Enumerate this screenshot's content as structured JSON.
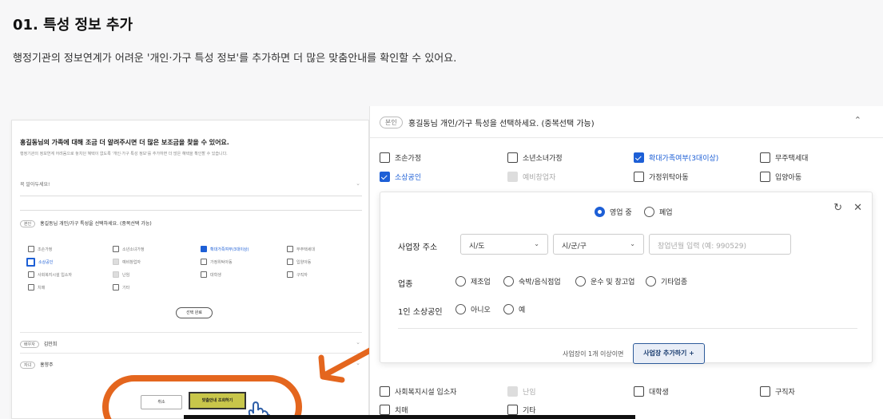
{
  "header": {
    "title": "01. 특성 정보 추가",
    "subtitle": "행정기관의 정보연계가 어려운 '개인·가구 특성 정보'를 추가하면 더 많은 맞춤안내를 확인할 수 있어요."
  },
  "left_panel": {
    "question": "홍길동님의 가족에 대해 조금 더 알려주시면 더 많은 보조금을 찾을 수 있어요.",
    "description": "행정기관의 정보연계 어려움으로 놓치던 혜택이 없도록 '개인·가구 특성 정보'를 추가하면 더 많은 혜택을 확인할 수 있습니다.",
    "input_placeholder": "꼭 알아두세요!",
    "section_badge": "본인",
    "section_title": "홍길동님 개인/가구 특성을 선택하세요. (중복선택 가능)",
    "options": [
      {
        "label": "조손가정",
        "state": "off"
      },
      {
        "label": "소년소녀가정",
        "state": "off"
      },
      {
        "label": "확대가족여부(3대이상)",
        "state": "on"
      },
      {
        "label": "무주택세대",
        "state": "off"
      },
      {
        "label": "소상공인",
        "state": "highlight"
      },
      {
        "label": "예비창업자",
        "state": "gray"
      },
      {
        "label": "가정위탁아동",
        "state": "off"
      },
      {
        "label": "입양아동",
        "state": "off"
      },
      {
        "label": "사회복지시설 입소자",
        "state": "off"
      },
      {
        "label": "난임",
        "state": "gray"
      },
      {
        "label": "대학생",
        "state": "off"
      },
      {
        "label": "구직자",
        "state": "off"
      },
      {
        "label": "치매",
        "state": "off"
      },
      {
        "label": "기타",
        "state": "off"
      }
    ],
    "select_done": "선택 완료",
    "members": [
      {
        "badge": "배우자",
        "name": "김민희"
      },
      {
        "badge": "자녀",
        "name": "홍향주"
      }
    ],
    "cancel_label": "취소",
    "view_label": "맞춤안내 조회하기"
  },
  "right_panel": {
    "badge": "본인",
    "title": "홍길동님 개인/가구 특성을 선택하세요. (중복선택 가능)",
    "options_top": [
      {
        "label": "조손가정",
        "state": "off"
      },
      {
        "label": "소년소녀가정",
        "state": "off"
      },
      {
        "label": "확대가족여부(3대이상)",
        "state": "on"
      },
      {
        "label": "무주택세대",
        "state": "off"
      },
      {
        "label": "소상공인",
        "state": "on"
      },
      {
        "label": "예비창업자",
        "state": "gray"
      },
      {
        "label": "가정위탁아동",
        "state": "off"
      },
      {
        "label": "입양아동",
        "state": "off"
      }
    ],
    "options_bottom": [
      {
        "label": "사회복지시설 입소자",
        "state": "off"
      },
      {
        "label": "난임",
        "state": "gray"
      },
      {
        "label": "대학생",
        "state": "off"
      },
      {
        "label": "구직자",
        "state": "off"
      },
      {
        "label": "치매",
        "state": "off"
      },
      {
        "label": "기타",
        "state": "off"
      }
    ],
    "sub": {
      "status_options": [
        "영업 중",
        "폐업"
      ],
      "status_selected": "영업 중",
      "addr_label": "사업장 주소",
      "sido": "시/도",
      "sigungu": "시/군/구",
      "bizno_placeholder": "창업년월 입력 (예: 990529)",
      "industry_label": "업종",
      "industries": [
        "제조업",
        "숙박/음식점업",
        "운수 및 창고업",
        "기타업종"
      ],
      "solo_label": "1인 소상공인",
      "solo_options": [
        "아니오",
        "예"
      ],
      "add_note": "사업장이 1개 이상이면",
      "add_button": "사업장 추가하기 +"
    }
  },
  "colors": {
    "accent": "#1d5fd6",
    "highlight_ring": "#e4661e",
    "view_button": "#c8c64a"
  }
}
